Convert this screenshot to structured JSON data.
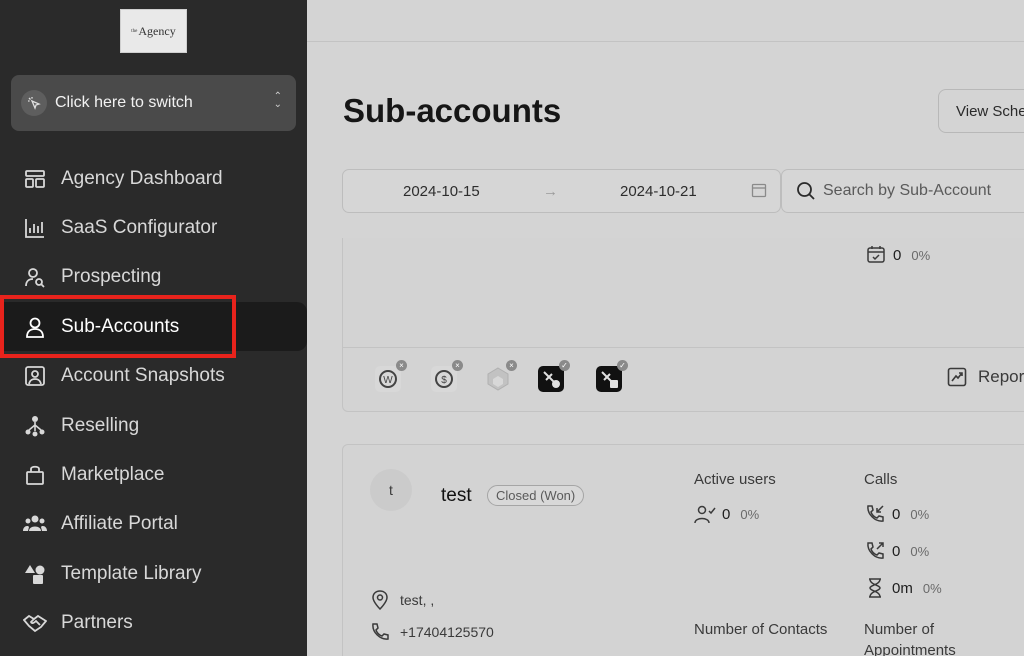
{
  "logo": {
    "prefix": "the",
    "text": "Agency"
  },
  "switcher": {
    "label": "Click here to switch"
  },
  "nav": [
    {
      "label": "Agency Dashboard",
      "icon": "dashboard-icon"
    },
    {
      "label": "SaaS Configurator",
      "icon": "bar-chart-icon"
    },
    {
      "label": "Prospecting",
      "icon": "user-search-icon"
    },
    {
      "label": "Sub-Accounts",
      "icon": "user-icon",
      "active": true
    },
    {
      "label": "Account Snapshots",
      "icon": "snapshot-icon"
    },
    {
      "label": "Reselling",
      "icon": "reselling-icon"
    },
    {
      "label": "Marketplace",
      "icon": "bag-icon"
    },
    {
      "label": "Affiliate Portal",
      "icon": "users-icon"
    },
    {
      "label": "Template Library",
      "icon": "shapes-icon"
    },
    {
      "label": "Partners",
      "icon": "handshake-icon"
    }
  ],
  "main": {
    "title": "Sub-accounts",
    "schedule_button": "View Sche",
    "date_start": "2024-10-15",
    "date_end": "2024-10-21",
    "search_placeholder": "Search by Sub-Account"
  },
  "card1": {
    "metric": {
      "value": "0",
      "pct": "0%"
    },
    "reports": "Repor"
  },
  "card2": {
    "avatar": "t",
    "name": "test",
    "status": "Closed (Won)",
    "active_users_label": "Active users",
    "active_users": {
      "value": "0",
      "pct": "0%"
    },
    "calls_label": "Calls",
    "calls_in": {
      "value": "0",
      "pct": "0%"
    },
    "calls_out": {
      "value": "0",
      "pct": "0%"
    },
    "call_time": {
      "value": "0m",
      "pct": "0%"
    },
    "address": "test, ,",
    "phone": "+17404125570",
    "contacts_label": "Number of Contacts",
    "appointments_label_1": "Number of",
    "appointments_label_2": "Appointments"
  },
  "colors": {
    "sidebar": "#2a2a2a",
    "highlight": "#e8231c",
    "main_bg": "#d4d4d4"
  }
}
